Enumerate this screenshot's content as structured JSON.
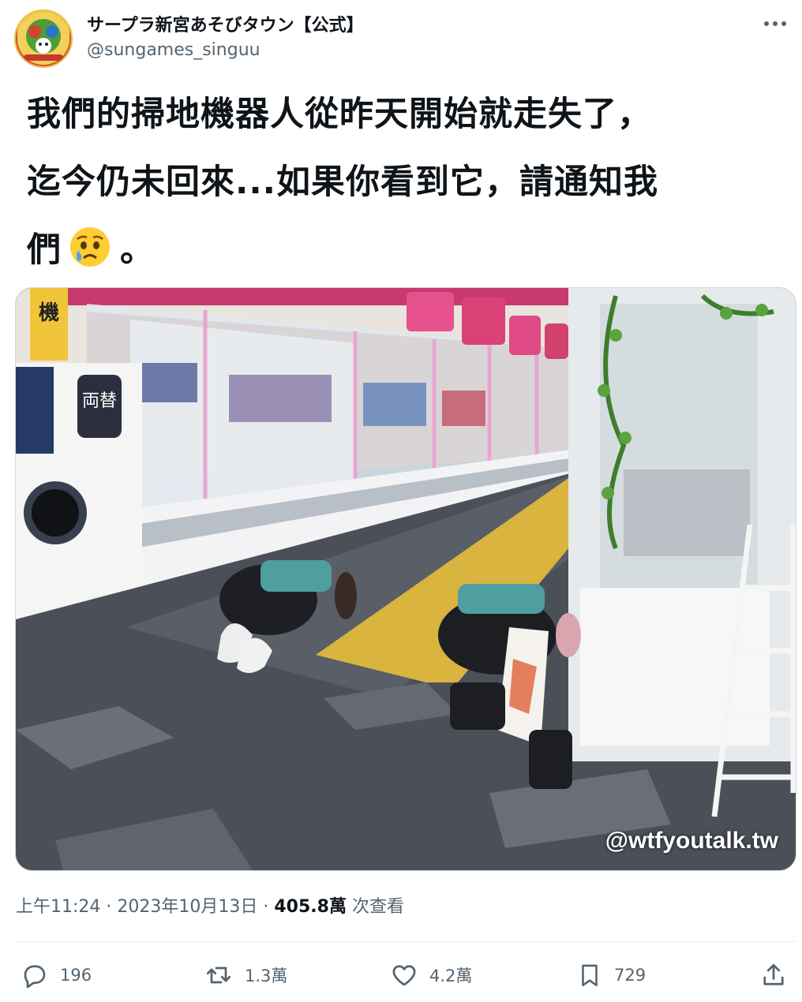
{
  "author": {
    "display_name": "サープラ新宮あそびタウン【公式】",
    "handle": "@sungames_singuu"
  },
  "tweet": {
    "lines": [
      "我們的掃地機器人從昨天開始就走失了，",
      "迄今仍未回來...如果你看到它，請通知我",
      "們"
    ],
    "line3_suffix": "。",
    "emoji": "crying-face"
  },
  "media": {
    "watermark": "@wtfyoutalk.tw",
    "scene_sign_1": "機",
    "scene_sign_2": "両替"
  },
  "meta": {
    "time": "上午11:24",
    "sep1": " · ",
    "date": "2023年10月13日",
    "sep2": " · ",
    "views": "405.8萬",
    "views_label": " 次查看"
  },
  "actions": {
    "replies": "196",
    "retweets": "1.3萬",
    "likes": "4.2萬",
    "bookmarks": "729"
  },
  "colors": {
    "text": "#0f1419",
    "secondary": "#536471",
    "divider": "#e6ecf0"
  }
}
